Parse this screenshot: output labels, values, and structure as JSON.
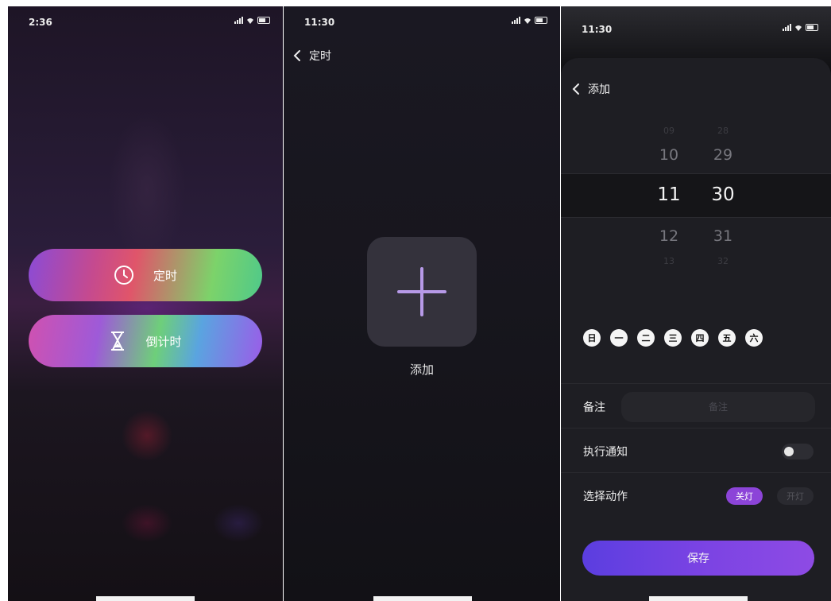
{
  "screen1": {
    "status_time": "2:36",
    "buttons": [
      {
        "label": "定时",
        "icon": "clock-icon"
      },
      {
        "label": "倒计时",
        "icon": "hourglass-icon"
      }
    ]
  },
  "screen2": {
    "status_time": "11:30",
    "nav_title": "定时",
    "add_label": "添加"
  },
  "screen3": {
    "status_time": "11:30",
    "nav_title": "添加",
    "picker": {
      "rows": [
        {
          "hour": "09",
          "minute": "28"
        },
        {
          "hour": "10",
          "minute": "29"
        },
        {
          "hour": "11",
          "minute": "30"
        },
        {
          "hour": "12",
          "minute": "31"
        },
        {
          "hour": "13",
          "minute": "32"
        }
      ]
    },
    "weekdays": [
      "日",
      "一",
      "二",
      "三",
      "四",
      "五",
      "六"
    ],
    "note_label": "备注",
    "note_placeholder": "备注",
    "notify_label": "执行通知",
    "action_label": "选择动作",
    "action_options": [
      "关灯",
      "开灯"
    ],
    "save_label": "保存"
  },
  "colors": {
    "accent_purple": "#8e4be4",
    "chip_active": "#8c44d8"
  }
}
